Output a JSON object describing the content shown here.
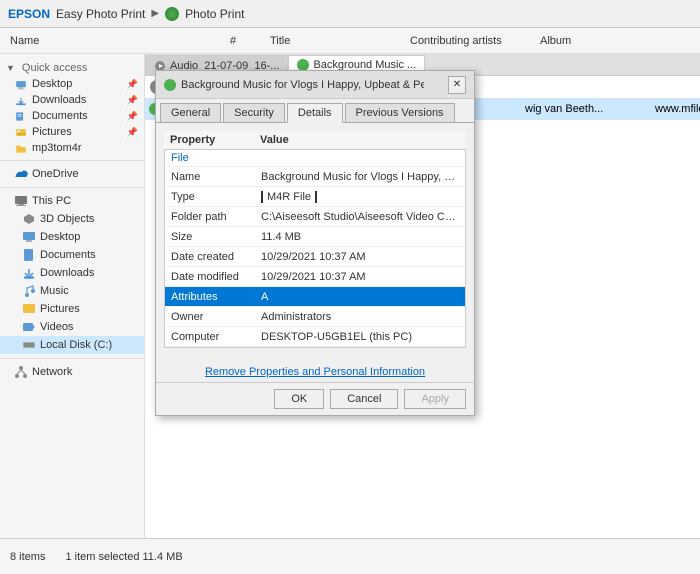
{
  "appBar": {
    "brand": "EPSON",
    "separator": "Easy Photo Print",
    "arrow": "▶",
    "appName": "Photo Print"
  },
  "explorerColumns": {
    "name": "Name",
    "hash": "#",
    "title": "Title",
    "contributingArtists": "Contributing artists",
    "album": "Album"
  },
  "fileTabs": [
    {
      "label": "Audio_21-07-09_16-...",
      "active": false
    },
    {
      "label": "Background Music ...",
      "active": true
    }
  ],
  "fileRows": [
    {
      "name": "Audio_21-07-09_16-...",
      "hash": "",
      "title": "",
      "contrib": "",
      "album": ""
    },
    {
      "name": "Background Music ...",
      "hash": "",
      "title": "",
      "contrib": "wig van Beeth...",
      "album": "www.mfiles.co.uk"
    }
  ],
  "sidebar": {
    "quickAccessLabel": "Quick access",
    "items": [
      {
        "label": "Desktop",
        "pinned": true,
        "type": "desktop"
      },
      {
        "label": "Downloads",
        "pinned": true,
        "type": "downloads"
      },
      {
        "label": "Documents",
        "pinned": true,
        "type": "documents"
      },
      {
        "label": "Pictures",
        "pinned": true,
        "type": "pictures"
      },
      {
        "label": "mp3tom4r",
        "pinned": false,
        "type": "folder"
      }
    ],
    "sections": [
      {
        "label": "OneDrive",
        "type": "onedrive"
      },
      {
        "label": "This PC",
        "type": "pc",
        "expanded": true
      },
      {
        "subItems": [
          {
            "label": "3D Objects",
            "type": "folder3d"
          },
          {
            "label": "Desktop",
            "type": "desktop"
          },
          {
            "label": "Documents",
            "type": "documents"
          },
          {
            "label": "Downloads",
            "type": "downloads"
          },
          {
            "label": "Music",
            "type": "music"
          },
          {
            "label": "Pictures",
            "type": "pictures"
          },
          {
            "label": "Videos",
            "type": "videos"
          },
          {
            "label": "Local Disk (C:)",
            "type": "disk",
            "selected": true
          }
        ]
      },
      {
        "label": "Network",
        "type": "network"
      }
    ]
  },
  "statusBar": {
    "itemCount": "8 items",
    "selectedInfo": "1 item selected  11.4 MB"
  },
  "dialog": {
    "title": "Background Music for Vlogs I Happy, Upbeat & Perfect...",
    "tabs": [
      "General",
      "Security",
      "Details",
      "Previous Versions"
    ],
    "activeTab": "Details",
    "tableHeader": {
      "property": "Property",
      "value": "Value"
    },
    "sectionFile": "File",
    "rows": [
      {
        "prop": "Name",
        "val": "Background Music for Vlogs I Happy, Upb...",
        "highlighted": false,
        "boxed": false
      },
      {
        "prop": "Type",
        "val": "M4R File",
        "highlighted": false,
        "boxed": true
      },
      {
        "prop": "Folder path",
        "val": "C:\\Aiseesoft Studio\\Aiseesoft Video Conve...",
        "highlighted": false,
        "boxed": false
      },
      {
        "prop": "Size",
        "val": "11.4 MB",
        "highlighted": false,
        "boxed": false
      },
      {
        "prop": "Date created",
        "val": "10/29/2021 10:37 AM",
        "highlighted": false,
        "boxed": false
      },
      {
        "prop": "Date modified",
        "val": "10/29/2021 10:37 AM",
        "highlighted": false,
        "boxed": false
      },
      {
        "prop": "Attributes",
        "val": "A",
        "highlighted": true,
        "boxed": false
      },
      {
        "prop": "Owner",
        "val": "Administrators",
        "highlighted": false,
        "boxed": false
      },
      {
        "prop": "Computer",
        "val": "DESKTOP-U5GB1EL (this PC)",
        "highlighted": false,
        "boxed": false
      }
    ],
    "linkText": "Remove Properties and Personal Information",
    "buttons": {
      "ok": "OK",
      "cancel": "Cancel",
      "apply": "Apply"
    }
  }
}
